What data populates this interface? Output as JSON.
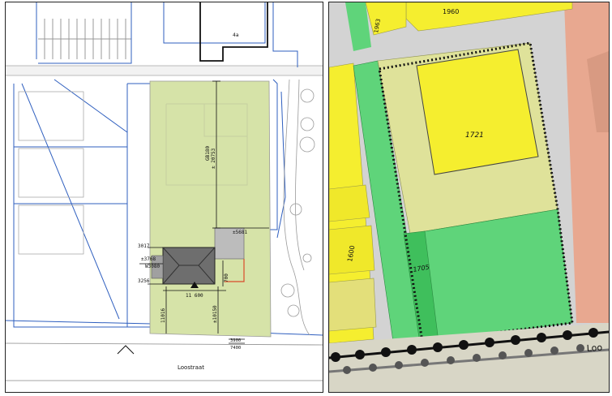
{
  "site_plan": {
    "street_name": "Loostraat",
    "north_block_label": "4a",
    "height_label": "11 600",
    "ground_label": "W3080",
    "dim_left_top": "3017",
    "dim_left_mid": "±3768",
    "dim_left_low": "3256",
    "dim_right": "±5681",
    "dim_main_vertical": "± 20753",
    "dim_right_vertical": "GB180",
    "dim_inner_vertical": "700",
    "dim_bottom_left": "11016",
    "dim_bottom_right": "±10150",
    "dim_bottom_offset": "3900",
    "dim_bottom_extra": "7400",
    "colors": {
      "plot_fill": "#d6e3a8",
      "building_fill": "#6e6e6e",
      "annex_fill": "#bcbcbc",
      "parcel_lines": "#2f5fbf",
      "red_edge": "#d94b2b"
    }
  },
  "zoning_map": {
    "street_name": "Loo",
    "parcel_labels": [
      "1960",
      "1963",
      "1721",
      "1705",
      "1600"
    ],
    "colors": {
      "residential": "#f5ee2f",
      "mixed": "#dfe29a",
      "green": "#5fd47a",
      "green_dark": "#3fbf5c",
      "road": "#d3d3d3",
      "commercial": "#e8a890",
      "boundary": "#111111"
    }
  }
}
